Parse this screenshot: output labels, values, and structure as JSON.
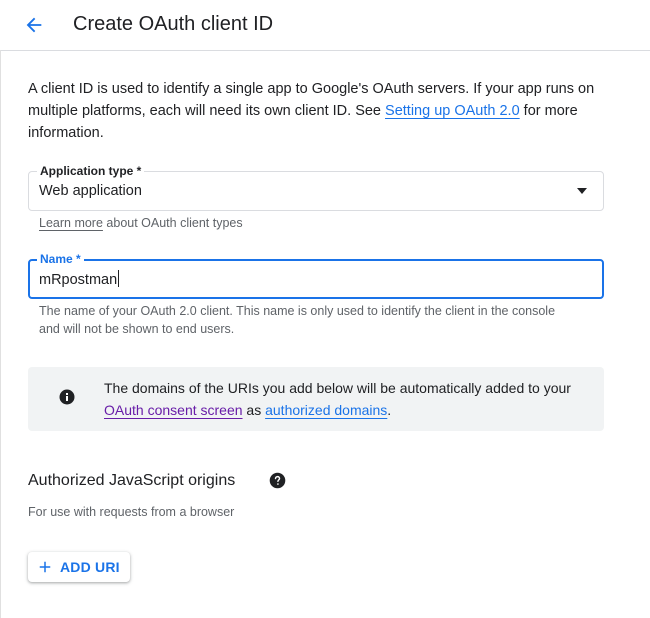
{
  "header": {
    "title": "Create OAuth client ID",
    "back_icon": "arrow-left-icon"
  },
  "intro": {
    "text_before_link": "A client ID is used to identify a single app to Google's OAuth servers. If your app runs on multiple platforms, each will need its own client ID. See ",
    "link_text": "Setting up OAuth 2.0",
    "text_after_link": " for more information."
  },
  "application_type": {
    "label": "Application type *",
    "value": "Web application",
    "helper_link": "Learn more",
    "helper_text": " about OAuth client types"
  },
  "name_field": {
    "label": "Name *",
    "value": "mRpostman",
    "helper_text": "The name of your OAuth 2.0 client. This name is only used to identify the client in the console and will not be shown to end users."
  },
  "info_box": {
    "icon": "info-icon",
    "text_before": "The domains of the URIs you add below will be automatically added to your ",
    "link1": "OAuth consent screen",
    "text_middle": " as ",
    "link2": "authorized domains",
    "text_after": "."
  },
  "js_origins": {
    "title": "Authorized JavaScript origins",
    "help_icon": "help-circle-icon",
    "subtitle": "For use with requests from a browser",
    "add_button_label": "ADD URI",
    "add_icon": "plus-icon"
  },
  "colors": {
    "accent": "#1a73e8",
    "visited_link": "#681da8",
    "info_background": "#f1f3f4",
    "text_primary": "#202124",
    "text_secondary": "#5f6368"
  }
}
